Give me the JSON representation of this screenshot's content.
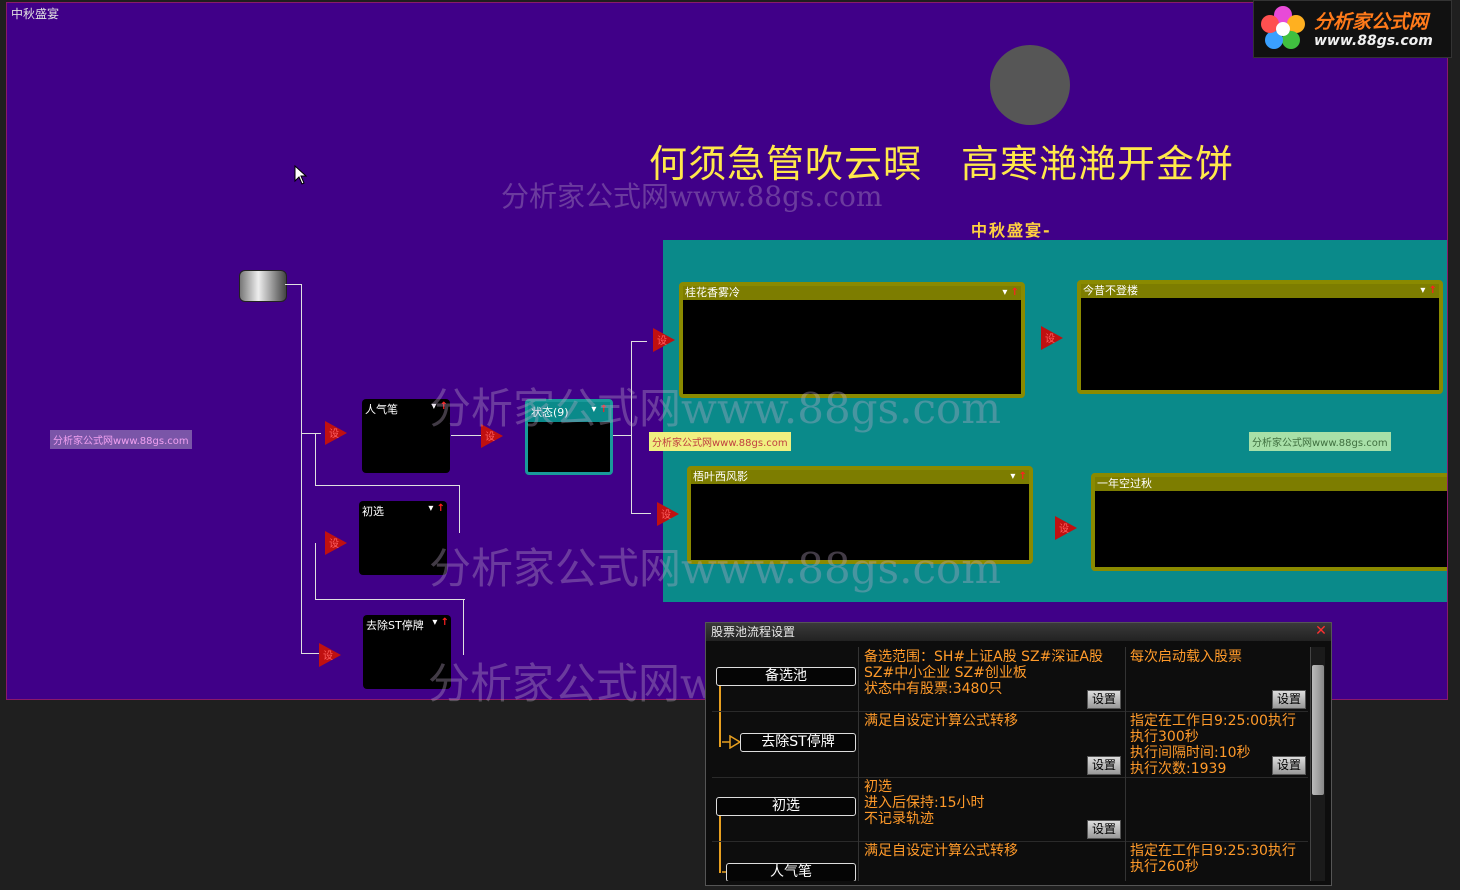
{
  "window": {
    "title": "中秋盛宴"
  },
  "logo": {
    "name": "分析家公式网",
    "url_text": "www.88gs.com"
  },
  "poem": "何须急管吹云暝　高寒滟滟开金饼",
  "subtitle": "中秋盛宴-",
  "watermarks": {
    "big": "分析家公式网www.88gs.com",
    "small": "分析家公式网www.88gs.com"
  },
  "pools": {
    "p1": "桂花香雾冷",
    "p2": "今昔不登楼",
    "p3": "梧叶西风影",
    "p4": "一年空过秋"
  },
  "nodes": {
    "n1": "人气笔",
    "n2": "初选",
    "n3": "去除ST停牌",
    "n4": "状态(9)"
  },
  "trigger_label": "设",
  "dialog": {
    "title": "股票池流程设置",
    "set_label": "设置",
    "rows": [
      {
        "pool": "备选池",
        "cond": [
          "备选范围：SH#上证A股 SZ#深证A股",
          "SZ#中小企业 SZ#创业板",
          "状态中有股票:3480只"
        ],
        "sched": [
          "每次启动载入股票"
        ]
      },
      {
        "pool": "去除ST停牌",
        "cond": [
          "满足自设定计算公式转移"
        ],
        "sched": [
          "指定在工作日9:25:00执行",
          "执行300秒",
          "执行间隔时间:10秒",
          "执行次数:1939"
        ]
      },
      {
        "pool": "初选",
        "cond": [
          "初选",
          "进入后保持:15小时",
          "不记录轨迹"
        ],
        "sched": []
      },
      {
        "pool": "人气笔",
        "cond": [
          "满足自设定计算公式转移"
        ],
        "sched": [
          "指定在工作日9:25:30执行",
          "执行260秒"
        ]
      }
    ]
  },
  "colors": {
    "canvas": "#400088",
    "teal": "#0a8a8a",
    "pool_border": "#8a8a00",
    "text_orange": "#ff9a2a",
    "poem": "#ffe84a"
  }
}
